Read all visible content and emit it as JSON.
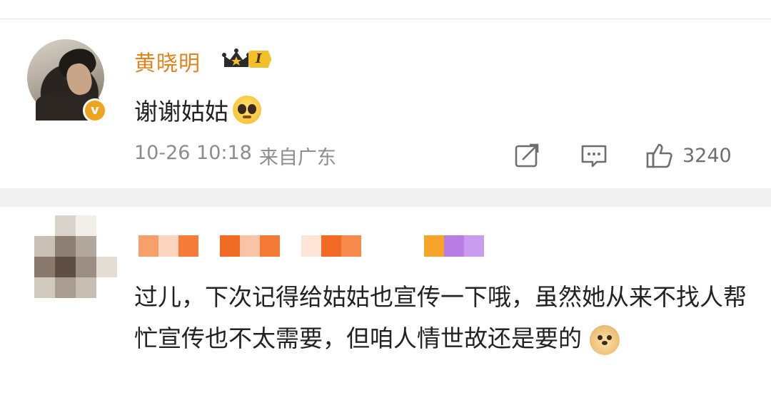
{
  "post": {
    "username": "黄晓明",
    "rank_label": "I",
    "verified_badge": "v",
    "message": "谢谢姑姑",
    "emoji": "pleading-face-icon",
    "date": "10-26 10:18",
    "location": "来自广东",
    "actions": {
      "share_icon": "share-icon",
      "comment_icon": "comment-icon",
      "like_icon": "thumbs-up-icon",
      "like_count": "3240"
    }
  },
  "comment": {
    "text": "过儿，下次记得给姑姑也宣传一下哦，虽然她从来不找人帮忙宣传也不太需要，但咱人情世故还是要的",
    "emoji": "doge-icon"
  },
  "colors": {
    "username": "#e4821c",
    "verified": "#f0a31f",
    "rank": "#f3c02b",
    "meta": "#8c8c8c",
    "divider": "#f0f0f0"
  }
}
